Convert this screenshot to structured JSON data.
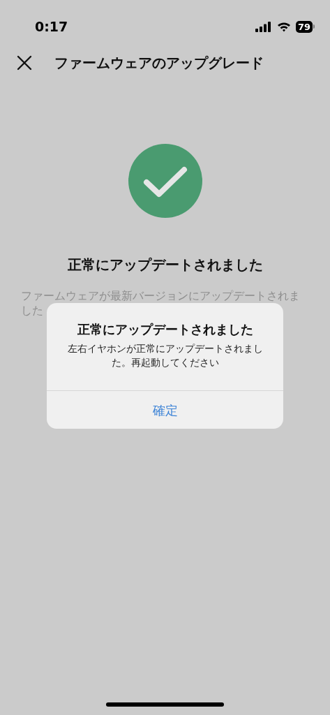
{
  "status_bar": {
    "time": "0:17",
    "battery": "79"
  },
  "nav": {
    "title": "ファームウェアのアップグレード"
  },
  "result": {
    "heading": "正常にアップデートされました",
    "description": "ファームウェアが最新バージョンにアップデートされました"
  },
  "dialog": {
    "title": "正常にアップデートされました",
    "message": "左右イヤホンが正常にアップデートされました。再起動してください",
    "buttons": [
      "確定"
    ]
  }
}
